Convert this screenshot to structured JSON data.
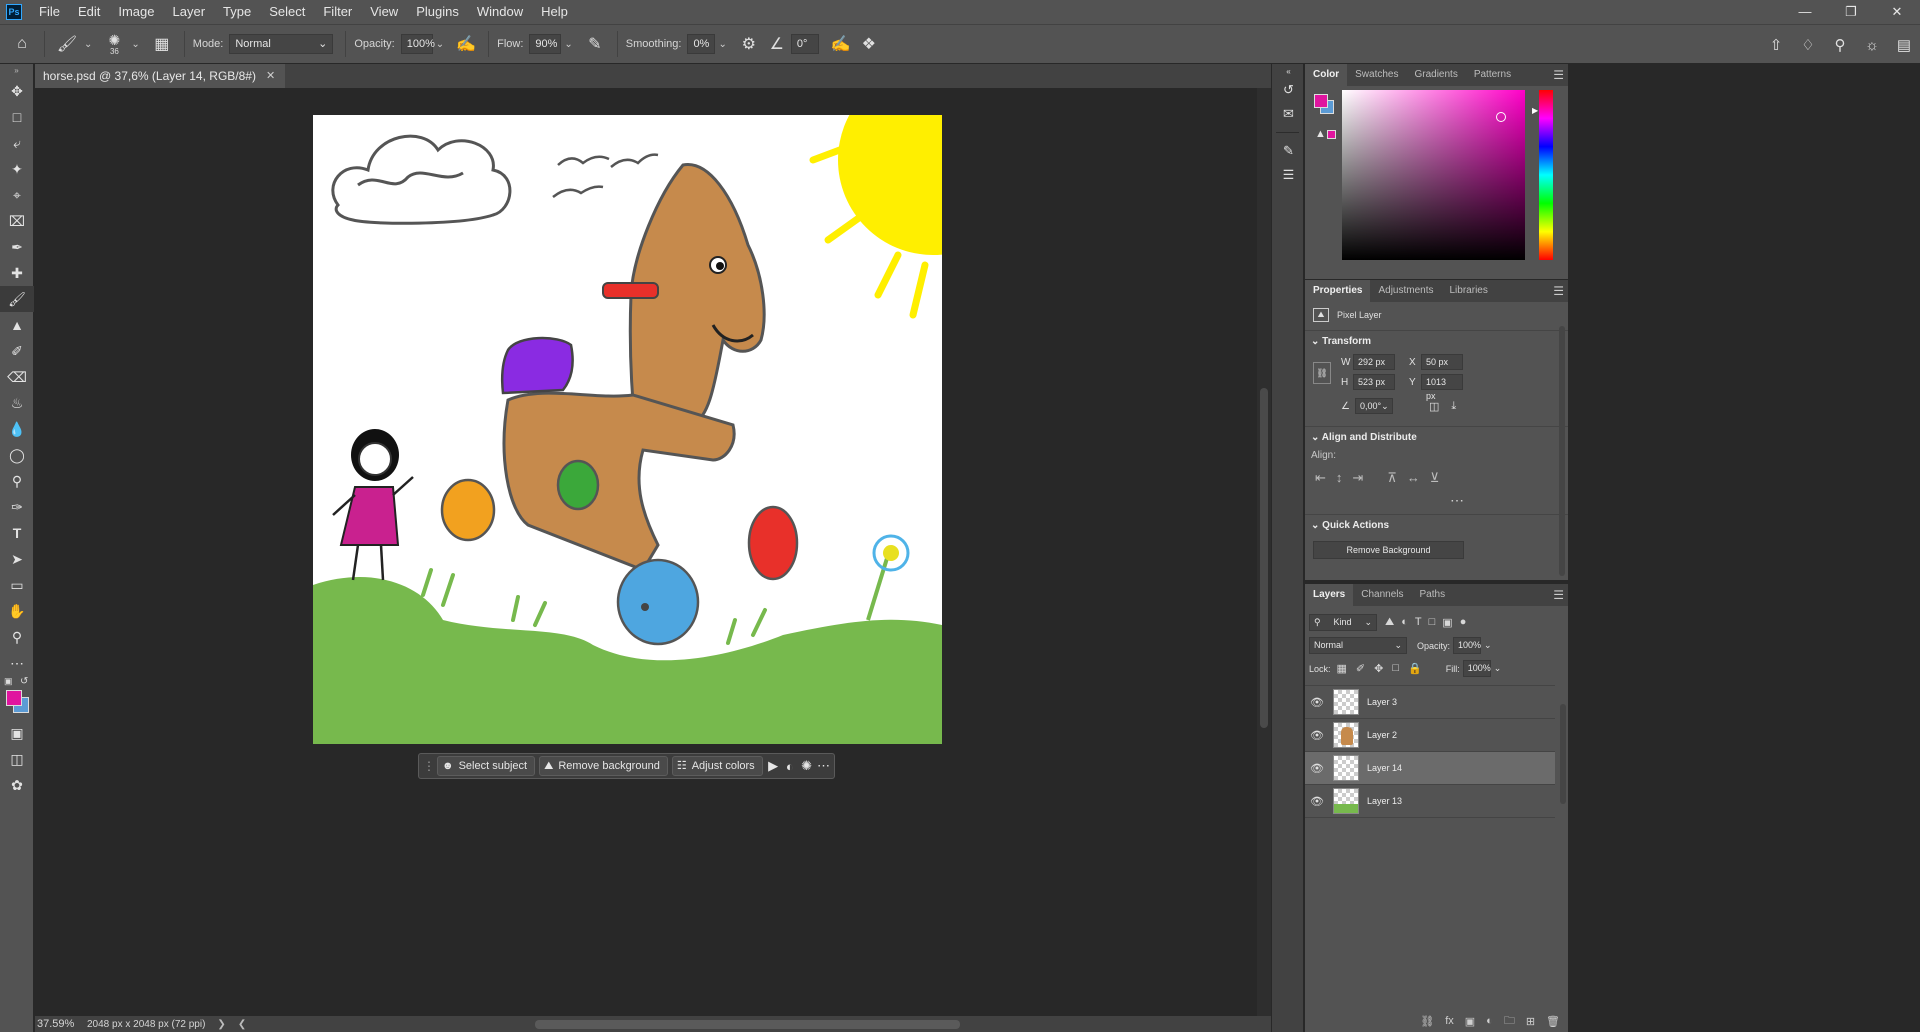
{
  "menu": {
    "items": [
      "File",
      "Edit",
      "Image",
      "Layer",
      "Type",
      "Select",
      "Filter",
      "View",
      "Plugins",
      "Window",
      "Help"
    ],
    "app_icon": "Ps",
    "window_controls": [
      "minimize-icon",
      "restore-icon",
      "close-icon"
    ]
  },
  "options_bar": {
    "brush_size": "36",
    "mode_label": "Mode:",
    "mode_value": "Normal",
    "opacity_label": "Opacity:",
    "opacity_value": "100%",
    "flow_label": "Flow:",
    "flow_value": "90%",
    "smoothing_label": "Smoothing:",
    "smoothing_value": "0%",
    "angle_value": "0°"
  },
  "document": {
    "tab_title": "horse.psd @ 37,6% (Layer 14, RGB/8#)",
    "zoom": "37.59%",
    "doc_info": "2048 px x 2048 px (72 ppi)"
  },
  "taskbar": {
    "select_subject": "Select subject",
    "remove_background": "Remove background",
    "adjust_colors": "Adjust colors"
  },
  "color_panel": {
    "tabs": [
      "Color",
      "Swatches",
      "Gradients",
      "Patterns"
    ],
    "foreground": "#e0159f",
    "background": "#5b9bd5"
  },
  "properties_panel": {
    "tabs": [
      "Properties",
      "Adjustments",
      "Libraries"
    ],
    "layer_type": "Pixel Layer",
    "transform_title": "Transform",
    "w_label": "W",
    "w_value": "292 px",
    "h_label": "H",
    "h_value": "523 px",
    "x_label": "X",
    "x_value": "50 px",
    "y_label": "Y",
    "y_value": "1013 px",
    "angle_value": "0,00°",
    "align_title": "Align and Distribute",
    "align_label": "Align:",
    "quick_actions_title": "Quick Actions",
    "remove_bg_button": "Remove Background"
  },
  "layers_panel": {
    "tabs": [
      "Layers",
      "Channels",
      "Paths"
    ],
    "filter_kind": "Kind",
    "blend_mode": "Normal",
    "opacity_label": "Opacity:",
    "opacity_value": "100%",
    "lock_label": "Lock:",
    "fill_label": "Fill:",
    "fill_value": "100%",
    "layers": [
      {
        "name": "Layer 3",
        "selected": false,
        "visible": true
      },
      {
        "name": "Layer 2",
        "selected": false,
        "visible": true
      },
      {
        "name": "Layer 14",
        "selected": true,
        "visible": true
      },
      {
        "name": "Layer 13",
        "selected": false,
        "visible": true
      }
    ]
  }
}
